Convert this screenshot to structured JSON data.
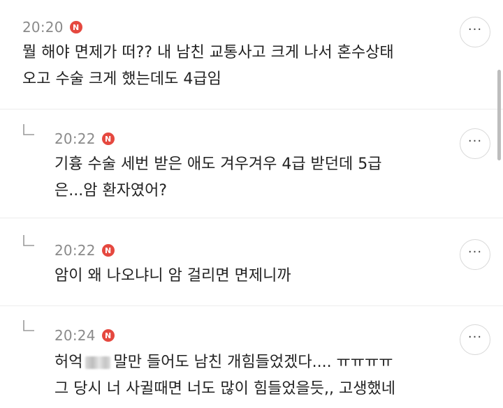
{
  "comments": [
    {
      "time": "20:20",
      "badge": "N",
      "line1": "뭘 해야 면제가 떠?? 내 남친 교통사고 크게 나서 혼수상태",
      "line2": "오고 수술 크게 했는데도 4급임",
      "more": "···"
    },
    {
      "time": "20:22",
      "badge": "N",
      "line1": "기흉 수술 세번 받은 애도 겨우겨우 4급 받던데 5급",
      "line2": "은...암 환자였어?",
      "more": "···"
    },
    {
      "time": "20:22",
      "badge": "N",
      "line1": "암이 왜 나오냐니 암 걸리면 면제니까",
      "more": "···"
    },
    {
      "time": "20:24",
      "badge": "N",
      "line1_a": "허억",
      "line1_b": "말만 들어도 남친 개힘들었겠다.... ㅠㅠㅠㅠ",
      "line2": "그 당시 너 사귈때면 너도 많이 힘들었을듯,, 고생했네",
      "more": "···"
    }
  ]
}
